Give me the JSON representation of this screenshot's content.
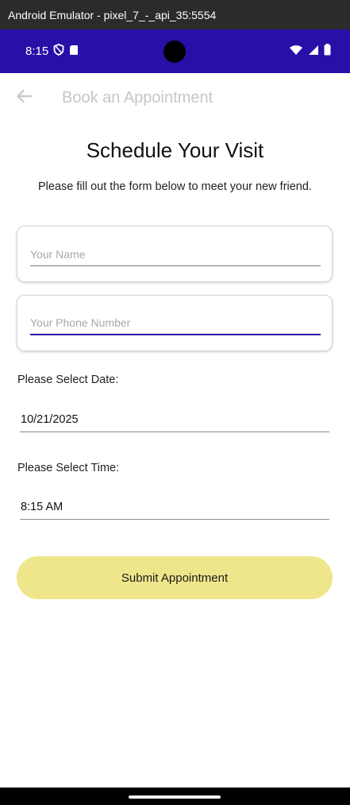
{
  "emulator": {
    "title": "Android Emulator - pixel_7_-_api_35:5554"
  },
  "status_bar": {
    "time": "8:15",
    "background_color": "#2a0ea8"
  },
  "app_bar": {
    "title": "Book an Appointment",
    "back_icon": "arrow-back-icon"
  },
  "form": {
    "title": "Schedule Your Visit",
    "subtitle": "Please fill out the form below to meet your new friend.",
    "name_field": {
      "placeholder": "Your Name",
      "value": ""
    },
    "phone_field": {
      "placeholder": "Your Phone Number",
      "value": ""
    },
    "date_label": "Please Select Date:",
    "date_value": "10/21/2025",
    "time_label": "Please Select Time:",
    "time_value": "8:15 AM",
    "submit_label": "Submit Appointment",
    "submit_color": "#efe68b",
    "focus_color": "#2a0ea8"
  }
}
